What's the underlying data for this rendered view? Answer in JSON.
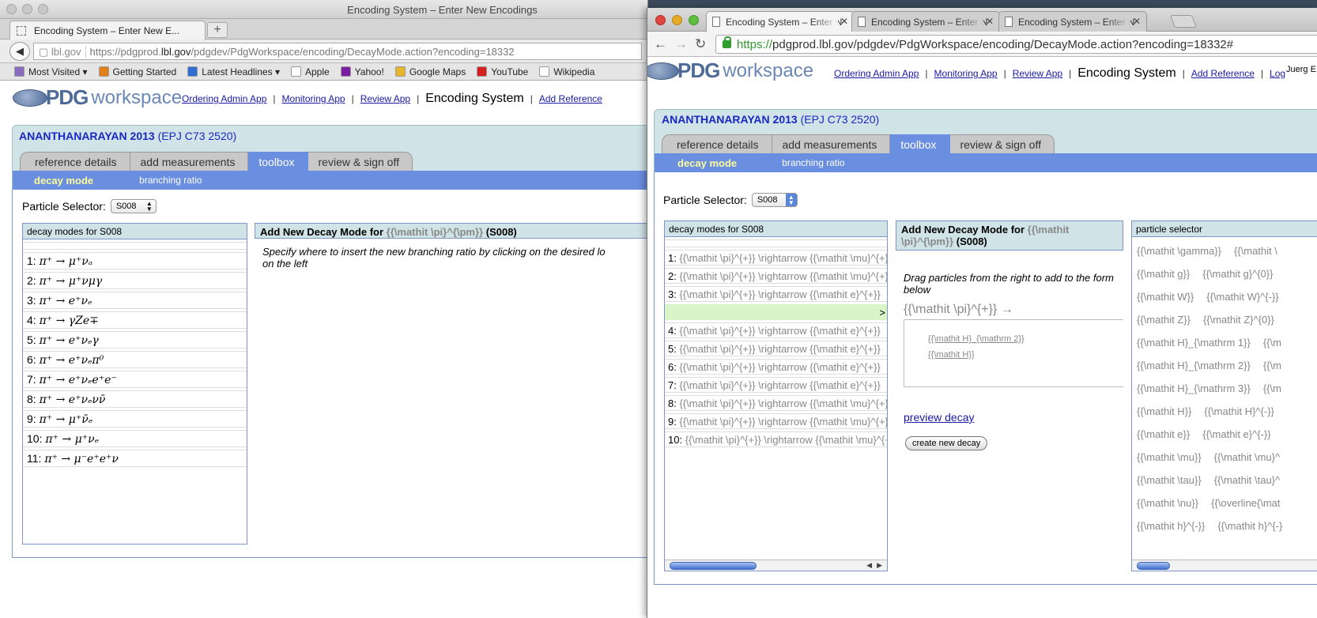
{
  "left_window": {
    "window_title": "Encoding System – Enter New Encodings",
    "tab_title": "Encoding System – Enter New E...",
    "new_tab_symbol": "+",
    "url_domain": "lbl.gov",
    "url_pre": "https://pdgprod.",
    "url_host": "lbl.gov",
    "url_path": "/pdgdev/PdgWorkspace/encoding/DecayMode.action?encoding=18332",
    "bookmarks": [
      {
        "label": "Most Visited ▾",
        "icon": "bookmarks-icon",
        "color": "#8a6bbf"
      },
      {
        "label": "Getting Started",
        "icon": "firefox-icon",
        "color": "#e0801a"
      },
      {
        "label": "Latest Headlines ▾",
        "icon": "rss-icon",
        "color": "#2f6fd1"
      },
      {
        "label": "Apple",
        "icon": "blank-page-icon",
        "color": "#ffffff"
      },
      {
        "label": "Yahoo!",
        "icon": "yahoo-icon",
        "color": "#7b1fa2"
      },
      {
        "label": "Google Maps",
        "icon": "maps-icon",
        "color": "#e8b62c"
      },
      {
        "label": "YouTube",
        "icon": "youtube-icon",
        "color": "#d62020"
      },
      {
        "label": "Wikipedia",
        "icon": "wikipedia-icon",
        "color": "#ffffff"
      }
    ],
    "logo": {
      "pdg": "PDG",
      "workspace": "workspace"
    },
    "app_nav": {
      "ordering": "Ordering Admin App",
      "monitoring": "Monitoring App",
      "review": "Review App",
      "encoding": "Encoding System",
      "add_reference": "Add Reference"
    },
    "reference": {
      "author": "ANANTHANARAYAN 2013",
      "journal": "(EPJ C73 2520)"
    },
    "steps": [
      "reference details",
      "add measurements",
      "toolbox",
      "review & sign off"
    ],
    "subnav": {
      "decay_mode": "decay mode",
      "branching_ratio": "branching ratio"
    },
    "particle_selector": {
      "label": "Particle Selector:",
      "value": "S008"
    },
    "decay_list": {
      "header": "decay modes for S008",
      "items": [
        {
          "n": "1:",
          "formula": "π⁺ → μ⁺νₐ"
        },
        {
          "n": "2:",
          "formula": "π⁺ → μ⁺νμγ"
        },
        {
          "n": "3:",
          "formula": "π⁺ → e⁺νₑ"
        },
        {
          "n": "4:",
          "formula": "π⁺ → γZe∓"
        },
        {
          "n": "5:",
          "formula": "π⁺ → e⁺νₑγ"
        },
        {
          "n": "6:",
          "formula": "π⁺ → e⁺νₑπ⁰"
        },
        {
          "n": "7:",
          "formula": "π⁺ → e⁺νₑe⁺e⁻"
        },
        {
          "n": "8:",
          "formula": "π⁺ → e⁺νₑνν̄"
        },
        {
          "n": "9:",
          "formula": "π⁺ → μ⁺ν̄ₑ"
        },
        {
          "n": "10:",
          "formula": "π⁺ → μ⁺νₑ"
        },
        {
          "n": "11:",
          "formula": "π⁺ → μ⁻e⁺e⁺ν"
        }
      ]
    },
    "add_new": {
      "title_pre": "Add New Decay Mode for",
      "particle": "{{\\mathit \\pi}^{\\pm}}",
      "code": "(S008)",
      "instruction": "Specify where to insert the new branching ratio by clicking on the desired lo",
      "instruction_2": "on the left"
    }
  },
  "right_window": {
    "tabs": [
      {
        "label": "Encoding System – Enter N"
      },
      {
        "label": "Encoding System – Enter N"
      },
      {
        "label": "Encoding System – Enter N"
      }
    ],
    "close_symbol": "✕",
    "url_https": "https://",
    "url_rest": "pdgprod.lbl.gov/pdgdev/PdgWorkspace/encoding/DecayMode.action?encoding=18332#",
    "logo": {
      "pdg": "PDG",
      "workspace": "workspace"
    },
    "app_nav": {
      "ordering": "Ordering Admin App",
      "monitoring": "Monitoring App",
      "review": "Review App",
      "encoding": "Encoding System",
      "add_reference": "Add Reference",
      "logout": "Log"
    },
    "user_label": "Juerg E",
    "reference": {
      "author": "ANANTHANARAYAN 2013",
      "journal": "(EPJ C73 2520)"
    },
    "steps": [
      "reference details",
      "add measurements",
      "toolbox",
      "review & sign off"
    ],
    "subnav": {
      "decay_mode": "decay mode",
      "branching_ratio": "branching ratio"
    },
    "particle_selector": {
      "label": "Particle Selector:",
      "value": "S008"
    },
    "decay_list": {
      "header": "decay modes for S008",
      "insert_marker": ">",
      "items": [
        {
          "n": "1:",
          "latex": "{{\\mathit \\pi}^{+}} \\rightarrow {{\\mathit \\mu}^{+}}"
        },
        {
          "n": "2:",
          "latex": "{{\\mathit \\pi}^{+}} \\rightarrow {{\\mathit \\mu}^{+}}"
        },
        {
          "n": "3:",
          "latex": "{{\\mathit \\pi}^{+}} \\rightarrow {{\\mathit e}^{+}}"
        },
        {
          "n": "4:",
          "latex": "{{\\mathit \\pi}^{+}} \\rightarrow {{\\mathit e}^{+}}"
        },
        {
          "n": "5:",
          "latex": "{{\\mathit \\pi}^{+}} \\rightarrow {{\\mathit e}^{+}}"
        },
        {
          "n": "6:",
          "latex": "{{\\mathit \\pi}^{+}} \\rightarrow {{\\mathit e}^{+}}"
        },
        {
          "n": "7:",
          "latex": "{{\\mathit \\pi}^{+}} \\rightarrow {{\\mathit e}^{+}}"
        },
        {
          "n": "8:",
          "latex": "{{\\mathit \\pi}^{+}} \\rightarrow {{\\mathit \\mu}^{+}}"
        },
        {
          "n": "9:",
          "latex": "{{\\mathit \\pi}^{+}} \\rightarrow {{\\mathit \\mu}^{+}}"
        },
        {
          "n": "10:",
          "latex": "{{\\mathit \\pi}^{+}} \\rightarrow {{\\mathit \\mu}^{+}}"
        }
      ]
    },
    "add_new": {
      "title_pre": "Add New Decay Mode for",
      "particle_line1": "{{\\mathit",
      "particle_line2": "\\pi}^{\\pm}}",
      "code": "(S008)",
      "instruction": "Drag particles from the right to add to the form below",
      "parent": "{{\\mathit \\pi}^{+}} →",
      "dropped": [
        "{{\\mathit H}_{\\mathrm 2}}",
        "{{\\mathit H}}"
      ],
      "preview_link": "preview decay",
      "create_button": "create new decay"
    },
    "particle_selector_box": {
      "header": "particle selector",
      "rows": [
        [
          "{{\\mathit \\gamma}}",
          "{{\\mathit \\"
        ],
        [
          "{{\\mathit g}}",
          "{{\\mathit g}^{0}}"
        ],
        [
          "{{\\mathit W}}",
          "{{\\mathit W}^{-}}"
        ],
        [
          "{{\\mathit Z}}",
          "{{\\mathit Z}^{0}}"
        ],
        [
          "{{\\mathit H}_{\\mathrm 1}}",
          "{{\\m"
        ],
        [
          "{{\\mathit H}_{\\mathrm 2}}",
          "{{\\m"
        ],
        [
          "{{\\mathit H}_{\\mathrm 3}}",
          "{{\\m"
        ],
        [
          "{{\\mathit H}}",
          "{{\\mathit H}^{-}}"
        ],
        [
          "{{\\mathit e}}",
          "{{\\mathit e}^{-}}"
        ],
        [
          "{{\\mathit \\mu}}",
          "{{\\mathit \\mu}^"
        ],
        [
          "{{\\mathit \\tau}}",
          "{{\\mathit \\tau}^"
        ],
        [
          "{{\\mathit \\nu}}",
          "{{\\overline{\\mat"
        ],
        [
          "{{\\mathit h}^{-}}",
          "{{\\mathit h}^{-}"
        ]
      ]
    }
  }
}
